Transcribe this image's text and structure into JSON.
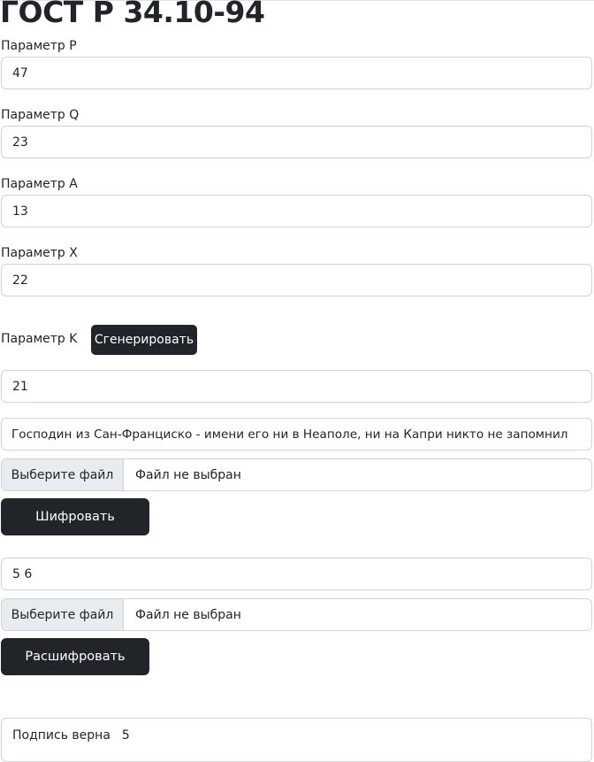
{
  "page": {
    "title": "ГОСТ Р 34.10-94"
  },
  "params": {
    "p": {
      "label": "Параметр P",
      "value": "47"
    },
    "q": {
      "label": "Параметр Q",
      "value": "23"
    },
    "a": {
      "label": "Параметр A",
      "value": "13"
    },
    "x": {
      "label": "Параметр X",
      "value": "22"
    },
    "k": {
      "label": "Параметр K",
      "value": "21",
      "generate_label": "Сгенерировать"
    }
  },
  "encrypt": {
    "message": "Господин из Сан-Франциско - имени его ни в Неаполе, ни на Капри никто не запомнил",
    "file_button": "Выберите файл",
    "file_status": "Файл не выбран",
    "submit_label": "Шифровать"
  },
  "decrypt": {
    "signature": "5 6",
    "file_button": "Выберите файл",
    "file_status": "Файл не выбран",
    "submit_label": "Расшифровать"
  },
  "result": {
    "text": "Подпись верна",
    "value": "5"
  }
}
